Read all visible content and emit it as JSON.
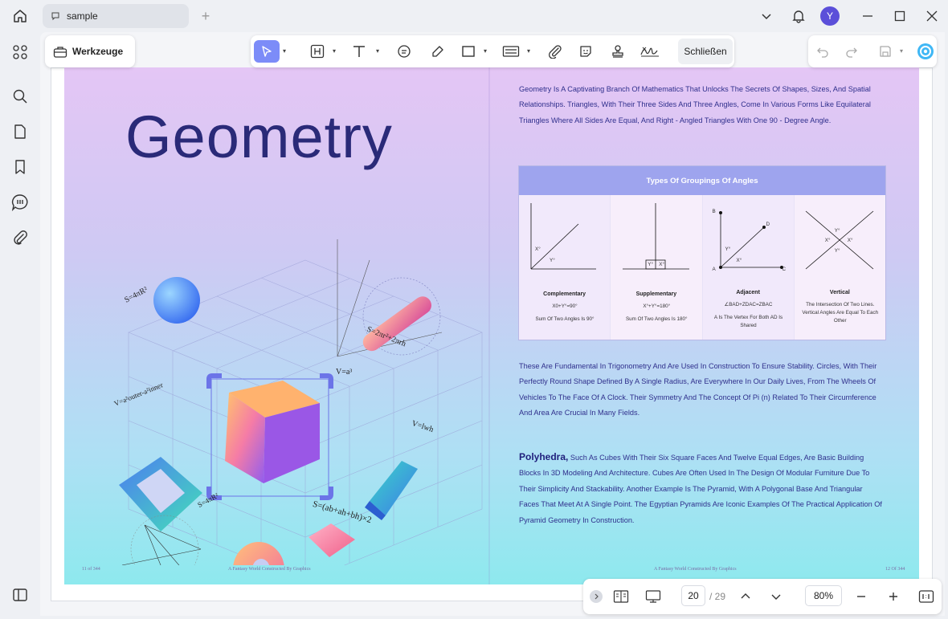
{
  "titlebar": {
    "tab_label": "sample",
    "avatar_initial": "Y"
  },
  "toolbar": {
    "werkzeuge_label": "Werkzeuge",
    "close_label": "Schließen",
    "accent_color": "#7c8cf8"
  },
  "left_page": {
    "title": "Geometry",
    "footer_left": "11 of 344",
    "footer_center": "A Fantasy World Constructed By Graphics",
    "formulas": {
      "sphere": "S=4πR²",
      "cylinder": "S=2πr²+2πrh",
      "cube": "V=a³",
      "torus_frame": "V=a²outer-a²inner",
      "prism": "V=lwh",
      "cone": "S=4πR²",
      "small_cube": "S=(ab+ah+bh)×2"
    }
  },
  "right_page": {
    "intro": "Geometry Is A Captivating Branch Of Mathematics That Unlocks The Secrets Of Shapes, Sizes, And Spatial Relationships. Triangles, With Their Three Sides And Three Angles, Come In Various Forms Like Equilateral Triangles Where All Sides Are Equal, And Right - Angled Triangles With One 90 - Degree Angle.",
    "table_title": "Types Of Groupings Of Angles",
    "angles": [
      {
        "name": "Complementary",
        "eq": "X0+Y°=90°",
        "desc": "Sum Of Two Angles Is 90°",
        "lbl1": "X°",
        "lbl2": "Y°"
      },
      {
        "name": "Supplementary",
        "eq": "X°+Y°=180°",
        "desc": "Sum Of Two Angles Is 180°",
        "lbl1": "Y°",
        "lbl2": "X°"
      },
      {
        "name": "Adjacent",
        "eq": "∠BAD+ZDAC=ZBAC",
        "desc": "A Is The Vertex For Both AD Is Shared",
        "lbl1": "Y°",
        "lbl2": "X°",
        "pts": [
          "B",
          "D",
          "A",
          "C"
        ]
      },
      {
        "name": "Vertical",
        "eq": "",
        "desc": "The Intersection Of Two Lines. Vertical Angles Are Equal To Each Other",
        "lbl1": "Y°",
        "lbl2": "X°"
      }
    ],
    "para2": "These Are Fundamental In Trigonometry And Are Used In Construction To Ensure Stability. Circles, With Their Perfectly Round Shape Defined By A Single Radius, Are Everywhere In Our Daily Lives, From The Wheels Of Vehicles To The Face Of A Clock. Their Symmetry And The Concept Of Pi (n) Related To Their Circumference And Area Are Crucial In Many Fields.",
    "para3_bold": "Polyhedra,",
    "para3": " Such As Cubes With Their Six Square Faces And Twelve Equal Edges, Are Basic Building Blocks In 3D Modeling And Architecture. Cubes Are Often Used In The Design Of Modular Furniture Due To Their Simplicity And Stackability. Another Example Is The Pyramid, With A Polygonal Base And Triangular Faces That Meet At A Single Point. The Egyptian Pyramids Are Iconic Examples Of The Practical Application Of Pyramid Geometry In Construction.",
    "footer_center": "A Fantasy World Constructed By Graphics",
    "footer_right": "12 Of 344"
  },
  "navbar": {
    "current_page": "20",
    "total_pages": "/ 29",
    "zoom": "80%"
  }
}
